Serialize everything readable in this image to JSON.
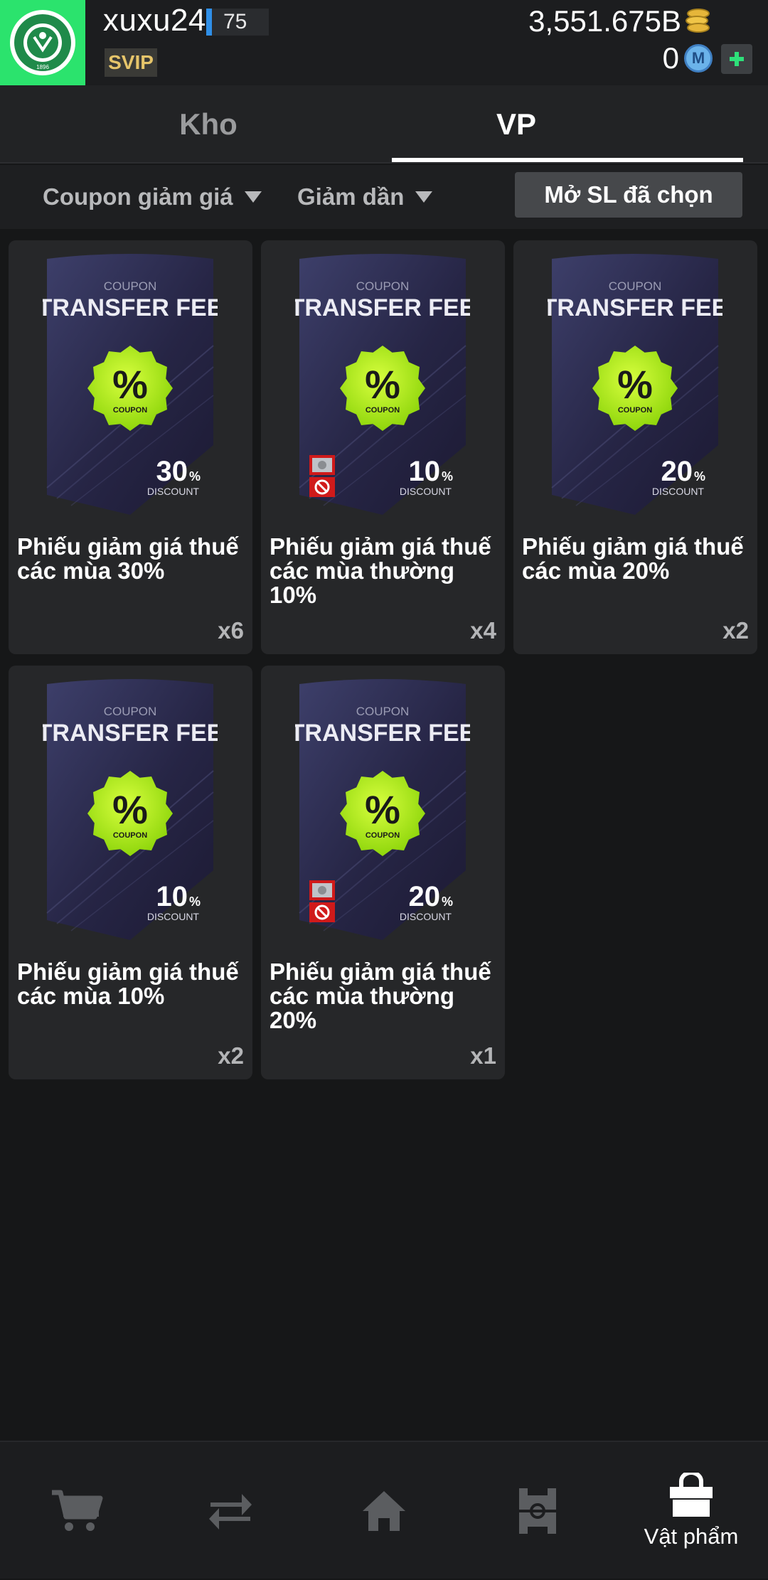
{
  "header": {
    "username": "xuxu24",
    "level": "75",
    "vip_badge": "SVIP",
    "coins": "3,551.675B",
    "mpoints": "0",
    "mpoints_icon_letter": "M",
    "club_badge_year": "1896",
    "colors": {
      "badge_bg": "#2be36d",
      "level_bar": "#2f8fe8",
      "svip_text": "#e6c56a"
    }
  },
  "tabs": [
    {
      "label": "Kho",
      "active": false
    },
    {
      "label": "VP",
      "active": true
    }
  ],
  "filters": {
    "category": "Coupon giảm giá",
    "sort": "Giảm dần",
    "open_selected_button": "Mở SL đã chọn"
  },
  "coupon_art": {
    "top_word": "COUPON",
    "main_word": "TRANSFER FEE",
    "badge_symbol": "%",
    "badge_word": "COUPON",
    "discount_word": "DISCOUNT"
  },
  "items": [
    {
      "title": "Phiếu giảm giá thuế các mùa 30%",
      "discount": "30",
      "qty": "x6",
      "restricted": false
    },
    {
      "title": "Phiếu giảm giá thuế các mùa thường 10%",
      "discount": "10",
      "qty": "x4",
      "restricted": true
    },
    {
      "title": "Phiếu giảm giá thuế các mùa 20%",
      "discount": "20",
      "qty": "x2",
      "restricted": false
    },
    {
      "title": "Phiếu giảm giá thuế các mùa 10%",
      "discount": "10",
      "qty": "x2",
      "restricted": false
    },
    {
      "title": "Phiếu giảm giá thuế các mùa thường 20%",
      "discount": "20",
      "qty": "x1",
      "restricted": true
    }
  ],
  "bottom_nav": [
    {
      "icon": "cart-icon",
      "label": "",
      "active": false
    },
    {
      "icon": "transfer-icon",
      "label": "",
      "active": false
    },
    {
      "icon": "home-icon",
      "label": "",
      "active": false
    },
    {
      "icon": "squad-pitch-icon",
      "label": "",
      "active": false
    },
    {
      "icon": "shopping-bag-icon",
      "label": "Vật phẩm",
      "active": true
    }
  ]
}
